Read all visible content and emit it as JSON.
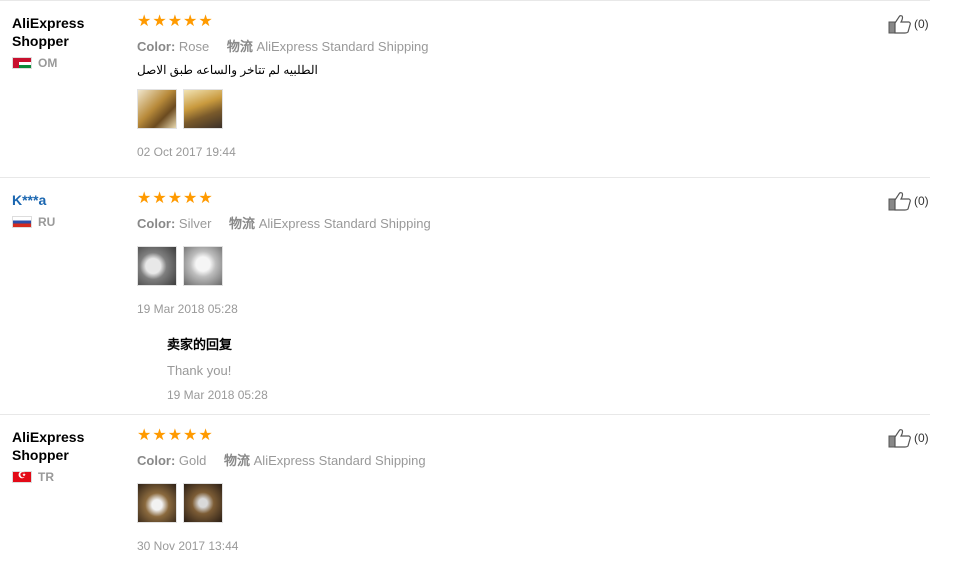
{
  "reviews": [
    {
      "name": "AliExpress Shopper",
      "country": "OM",
      "color_label": "Color:",
      "color_value": "Rose",
      "shipping_label": "物流",
      "shipping_value": "AliExpress Standard Shipping",
      "text": "الطلبيه لم تتاخر والساعه طبق الاصل",
      "date": "02 Oct 2017 19:44",
      "likes": "(0)"
    },
    {
      "name": "K***a",
      "country": "RU",
      "color_label": "Color:",
      "color_value": "Silver",
      "shipping_label": "物流",
      "shipping_value": "AliExpress Standard Shipping",
      "text": "",
      "date": "19 Mar 2018 05:28",
      "likes": "(0)",
      "reply": {
        "title": "卖家的回复",
        "text": "Thank you!",
        "date": "19 Mar 2018 05:28"
      }
    },
    {
      "name": "AliExpress Shopper",
      "country": "TR",
      "color_label": "Color:",
      "color_value": "Gold",
      "shipping_label": "物流",
      "shipping_value": "AliExpress Standard Shipping",
      "text": "",
      "date": "30 Nov 2017 13:44",
      "likes": "(0)"
    }
  ],
  "rating_stars": 5,
  "star_color": "#ff9a00"
}
